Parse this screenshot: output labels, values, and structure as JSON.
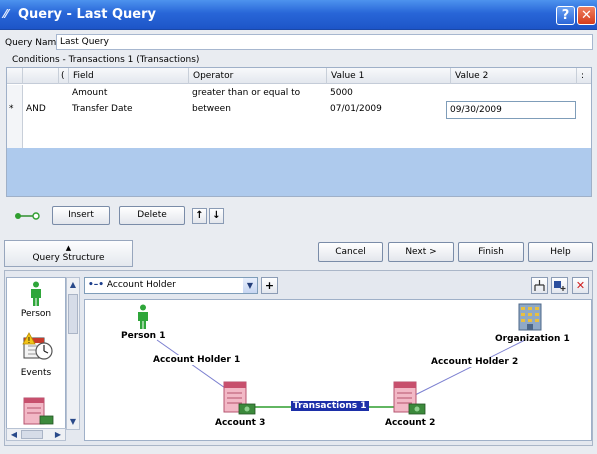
{
  "window": {
    "title": "Query - Last Query",
    "help_symbol": "?",
    "close_symbol": "✕"
  },
  "query_name": {
    "label": "Query Name:",
    "value": "Last Query"
  },
  "conditions": {
    "label": "Conditions - Transactions 1 (Transactions)",
    "columns": [
      "(",
      "Field",
      "Operator",
      "Value 1",
      "Value 2",
      ":"
    ],
    "rows": [
      {
        "marker": "",
        "connector": "",
        "paren": "",
        "field": "Amount",
        "operator": "greater than or equal to",
        "value1": "5000",
        "value2": ""
      },
      {
        "marker": "*",
        "connector": "AND",
        "paren": "",
        "field": "Transfer Date",
        "operator": "between",
        "value1": "07/01/2009",
        "value2": "09/30/2009"
      }
    ]
  },
  "row_buttons": {
    "insert": "Insert",
    "delete": "Delete",
    "up_symbol": "↑",
    "down_symbol": "↓"
  },
  "query_structure": {
    "arrow": "▲",
    "label": "Query Structure"
  },
  "nav_buttons": {
    "cancel": "Cancel",
    "next": "Next >",
    "finish": "Finish",
    "help": "Help"
  },
  "palette": {
    "items": [
      "Person",
      "Events",
      ""
    ]
  },
  "link_combo": {
    "value": "Account Holder",
    "add_symbol": "+"
  },
  "graph": {
    "nodes": [
      "Person 1",
      "Organization 1",
      "Account 3",
      "Account 2"
    ],
    "edges": [
      "Account Holder 1",
      "Account Holder 2",
      "Transactions 1"
    ]
  },
  "colors": {
    "title_bar": "#2866d8",
    "selection": "#1c2fa8",
    "grid_empty": "#aecaed",
    "account_link": "#2f9e2f",
    "holder_link": "#7b7fd0"
  }
}
